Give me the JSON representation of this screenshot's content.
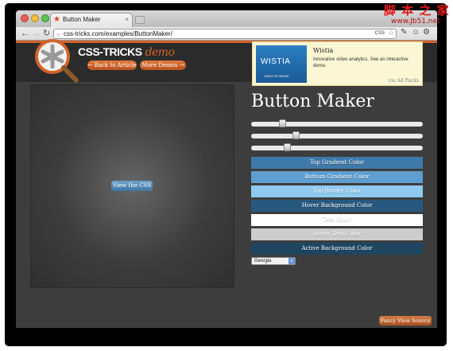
{
  "browser": {
    "tab_title": "Button Maker",
    "url": "css-tricks.com/examples/ButtonMaker/"
  },
  "site": {
    "logo_text": "CSS-TRICKS",
    "logo_suffix": "demo",
    "back_button": "← Back to Article",
    "more_demos_button": "More Demos →"
  },
  "ad": {
    "brand_text": "WISTIA",
    "brand_sub": "VIDEO AT WORK",
    "title": "Wistia",
    "text": "Innovative video analytics. See an interactive demo.",
    "via": "via Ad Packs"
  },
  "preview": {
    "button_label": "View the CSS"
  },
  "controls": {
    "heading": "Button Maker",
    "sliders": [
      {
        "name": "slider-1",
        "value": 0.17
      },
      {
        "name": "slider-2",
        "value": 0.25
      },
      {
        "name": "slider-3",
        "value": 0.2
      }
    ],
    "color_bars": [
      {
        "label": "Top Gradient Color",
        "bg": "#3f79a8",
        "fg": "#ffffff"
      },
      {
        "label": "Bottom Gradient Color",
        "bg": "#5e9ed0",
        "fg": "#ffffff"
      },
      {
        "label": "Top Border Color",
        "bg": "#8fc9ef",
        "fg": "#ffffff"
      },
      {
        "label": "Hover Background Color",
        "bg": "#27597f",
        "fg": "#ffffff"
      },
      {
        "label": "Text Color",
        "bg": "#ffffff",
        "fg": "#ffffff"
      },
      {
        "label": "Hover Text Color",
        "bg": "#cccccc",
        "fg": "#ffffff"
      },
      {
        "label": "Active Background Color",
        "bg": "#1e4661",
        "fg": "#ffffff"
      }
    ],
    "font_select": "Georgia"
  },
  "footer": {
    "fancy_button": "Fancy View Source"
  },
  "watermark": {
    "line1": "脚 本 之 家",
    "line2": "www.Jb51.net"
  }
}
